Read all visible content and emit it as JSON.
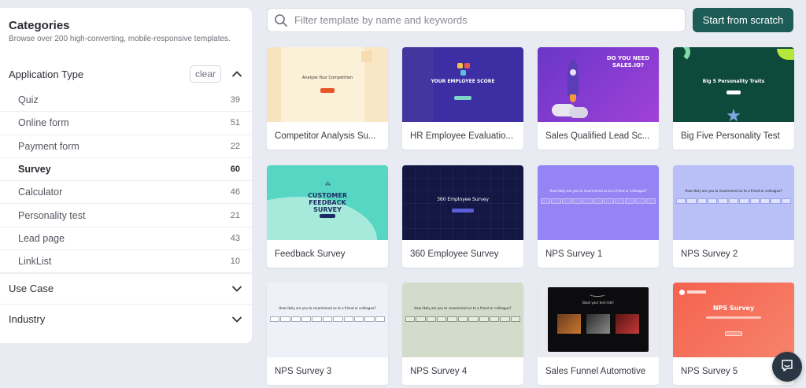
{
  "sidebar": {
    "title": "Categories",
    "subtitle": "Browse over 200 high-converting, mobile-responsive templates.",
    "application_type": {
      "label": "Application Type",
      "clear_label": "clear",
      "items": [
        {
          "label": "Quiz",
          "count": "39"
        },
        {
          "label": "Online form",
          "count": "51"
        },
        {
          "label": "Payment form",
          "count": "22"
        },
        {
          "label": "Survey",
          "count": "60",
          "active": true
        },
        {
          "label": "Calculator",
          "count": "46"
        },
        {
          "label": "Personality test",
          "count": "21"
        },
        {
          "label": "Lead page",
          "count": "43"
        },
        {
          "label": "LinkList",
          "count": "10"
        }
      ]
    },
    "use_case": {
      "label": "Use Case"
    },
    "industry": {
      "label": "Industry"
    }
  },
  "search": {
    "placeholder": "Filter template by name and keywords",
    "value": ""
  },
  "toolbar": {
    "scratch_label": "Start from scratch"
  },
  "templates": [
    {
      "title": "Competitor Analysis Su...",
      "thumb_text": "Analyze Your Competition"
    },
    {
      "title": "HR Employee Evaluatio...",
      "thumb_text": "YOUR EMPLOYEE SCORE"
    },
    {
      "title": "Sales Qualified Lead Sc...",
      "thumb_text": "DO YOU NEED SALES.IO?"
    },
    {
      "title": "Big Five Personality Test",
      "thumb_text": "Big 5 Personality Traits"
    },
    {
      "title": "Feedback Survey",
      "thumb_text": "CUSTOMER FEEDBACK SURVEY"
    },
    {
      "title": "360 Employee Survey",
      "thumb_text": "360 Employee Survey"
    },
    {
      "title": "NPS Survey 1",
      "thumb_text": "How likely are you to recommend us to a friend or colleague?"
    },
    {
      "title": "NPS Survey 2",
      "thumb_text": "How likely are you to recommend us to a friend or colleague?"
    },
    {
      "title": "NPS Survey 3",
      "thumb_text": "How likely are you to recommend us to a friend or colleague?"
    },
    {
      "title": "NPS Survey 4",
      "thumb_text": "How likely are you to recommend us to a friend or colleague?"
    },
    {
      "title": "Sales Funnel Automotive",
      "thumb_text": "Book your test ride!"
    },
    {
      "title": "NPS Survey 5",
      "thumb_text": "NPS Survey"
    }
  ],
  "colors": {
    "accent": "#1d5c56",
    "page_bg": "#e9ebf3"
  },
  "icons": {
    "search": "search-icon",
    "chevron_up": "chevron-up-icon",
    "chevron_down": "chevron-down-icon",
    "chat": "chat-icon"
  }
}
